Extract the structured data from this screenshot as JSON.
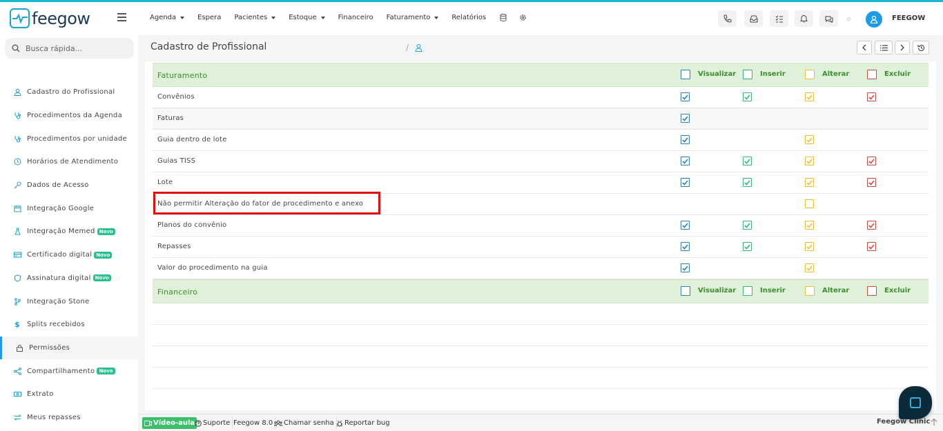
{
  "app": {
    "logo_text": "feegow",
    "user_name": "FEEGOW"
  },
  "nav": {
    "items": [
      {
        "label": "Agenda",
        "caret": true
      },
      {
        "label": "Espera",
        "caret": false
      },
      {
        "label": "Pacientes",
        "caret": true
      },
      {
        "label": "Estoque",
        "caret": true
      },
      {
        "label": "Financeiro",
        "caret": false
      },
      {
        "label": "Faturamento",
        "caret": true
      },
      {
        "label": "Relatórios",
        "caret": false
      }
    ]
  },
  "search": {
    "placeholder": "Busca rápida..."
  },
  "sidebar": {
    "items": [
      {
        "label": "Cadastro do Profissional",
        "badge": ""
      },
      {
        "label": "Procedimentos da Agenda",
        "badge": ""
      },
      {
        "label": "Procedimentos por unidade",
        "badge": ""
      },
      {
        "label": "Horários de Atendimento",
        "badge": ""
      },
      {
        "label": "Dados de Acesso",
        "badge": ""
      },
      {
        "label": "Integração Google",
        "badge": ""
      },
      {
        "label": "Integração Memed",
        "badge": "Novo"
      },
      {
        "label": "Certificado digital",
        "badge": "Novo"
      },
      {
        "label": "Assinatura digital",
        "badge": "Novo"
      },
      {
        "label": "Integração Stone",
        "badge": ""
      },
      {
        "label": "Splits recebidos",
        "badge": ""
      },
      {
        "label": "Permissões",
        "badge": ""
      },
      {
        "label": "Compartilhamento",
        "badge": "Novo"
      },
      {
        "label": "Extrato",
        "badge": ""
      },
      {
        "label": "Meus repasses",
        "badge": ""
      }
    ]
  },
  "page": {
    "title": "Cadastro de Profissional",
    "separator": "/"
  },
  "permissions": {
    "columns": [
      "Visualizar",
      "Inserir",
      "Alterar",
      "Excluir"
    ],
    "group1": "Faturamento",
    "rows": [
      {
        "label": "Convênios"
      },
      {
        "label": "Faturas"
      },
      {
        "label": "Guia dentro de lote"
      },
      {
        "label": "Guias TISS"
      },
      {
        "label": "Lote"
      },
      {
        "label": "Não permitir Alteração do fator de procedimento e anexo"
      },
      {
        "label": "Planos do convênio"
      },
      {
        "label": "Repasses"
      },
      {
        "label": "Valor do procedimento na guia"
      }
    ],
    "group2": "Financeiro"
  },
  "footer": {
    "video": "Vídeo-aula",
    "support": "Suporte",
    "version": "Feegow 8.0",
    "call": "Chamar senha",
    "bug": "Reportar bug",
    "brand": "Feegow Clinic"
  },
  "colors": {
    "accent": "#1b9be8",
    "group_bg": "#dff1d8",
    "group_text": "#3c8d2f",
    "highlight": "#e30b0b"
  }
}
